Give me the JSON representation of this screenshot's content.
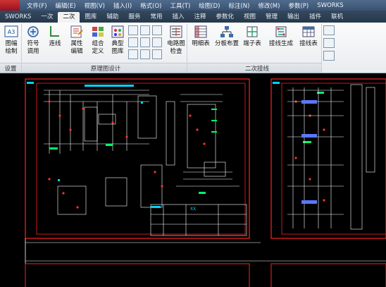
{
  "menu": {
    "items": [
      "文件(F)",
      "编辑(E)",
      "视图(V)",
      "插入(I)",
      "格式(O)",
      "工具(T)",
      "绘图(D)",
      "标注(N)",
      "修改(M)",
      "参数(P)",
      "SWORKS"
    ]
  },
  "tabs": {
    "items": [
      "SWORKS",
      "一次",
      "二次",
      "图库",
      "辅助",
      "服务",
      "常用",
      "插入",
      "注释",
      "参数化",
      "视图",
      "管理",
      "输出",
      "插件",
      "联机"
    ],
    "active": "二次"
  },
  "ribbon": {
    "settings_group": {
      "label": "设置",
      "frame_button": "图幅\n绘制",
      "frame_button_icon_text": "A3"
    },
    "schematic_group": {
      "label": "原理图设计",
      "symbol_button": "符号\n调用",
      "wire_button": "连线",
      "property_button": "属性\n编辑",
      "combo_button": "组合\n定义",
      "library_button": "典型\n图库",
      "circuit_check_button": "电路图\n检查"
    },
    "secondary_wiring_group": {
      "label": "二次接线",
      "details_button": "明细表",
      "board_button": "分板布置",
      "terminal_button": "端子表",
      "wiring_gen_button": "接线生成",
      "wiring_table_button": "接线表"
    }
  },
  "drawing": {
    "title_block_text": "XX",
    "accent": "#ff2020",
    "line_color": "#ffffff",
    "title_block_color": "#00d4ff",
    "highlight_color": "#00ff66"
  }
}
